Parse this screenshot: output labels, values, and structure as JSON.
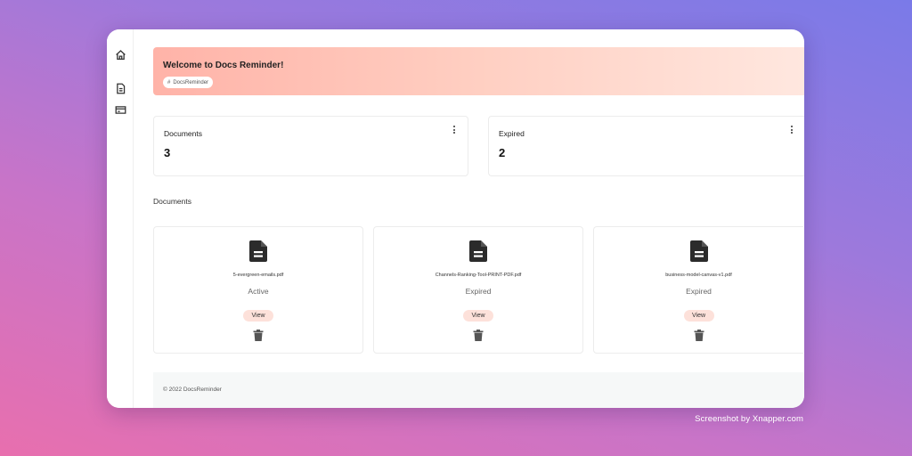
{
  "sidebar": {
    "icons": [
      "home-icon",
      "document-icon",
      "credit-card-icon"
    ]
  },
  "banner": {
    "title": "Welcome to Docs Reminder!",
    "tag_symbol": "#",
    "tag_label": "DocsReminder"
  },
  "stats": [
    {
      "title": "Documents",
      "value": "3"
    },
    {
      "title": "Expired",
      "value": "2"
    }
  ],
  "documents_section": {
    "title": "Documents",
    "items": [
      {
        "filename": "5-evergreen-emails.pdf",
        "status": "Active",
        "view_label": "View"
      },
      {
        "filename": "Channels-Ranking-Tool-PRINT-PDF.pdf",
        "status": "Expired",
        "view_label": "View"
      },
      {
        "filename": "business-model-canvas-v1.pdf",
        "status": "Expired",
        "view_label": "View"
      }
    ]
  },
  "footer": {
    "text": "© 2022 DocsReminder"
  },
  "watermark": "Screenshot by Xnapper.com",
  "colors": {
    "banner_start": "#ffb3a8",
    "banner_end": "#ffe7df",
    "view_button_bg": "#fde1da",
    "footer_bg": "#f6f8f8"
  }
}
